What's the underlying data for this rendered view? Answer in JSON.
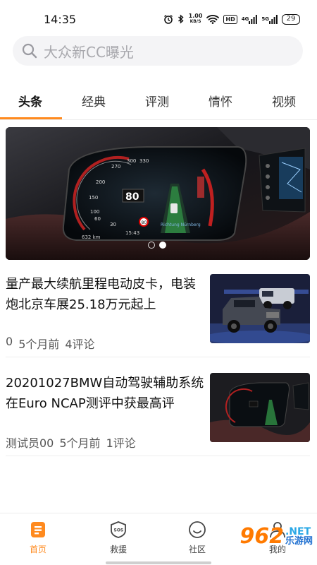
{
  "status_bar": {
    "time": "14:35",
    "speed_value": "1.00",
    "speed_unit": "KB/S",
    "hd_badge": "HD",
    "network_1": "4G",
    "network_2": "5G",
    "battery": "29",
    "icons": [
      "alarm-icon",
      "bluetooth-icon",
      "wifi-icon",
      "signal-icon"
    ]
  },
  "search": {
    "placeholder": "大众新CC曝光"
  },
  "tabs": [
    {
      "label": "头条",
      "active": true
    },
    {
      "label": "经典"
    },
    {
      "label": "评测"
    },
    {
      "label": "情怀"
    },
    {
      "label": "视频"
    }
  ],
  "banner": {
    "slides": 2,
    "active_slide": 2,
    "speed_readout": "80",
    "range_readout": "632",
    "clock_readout": "15:43",
    "nav_location": "Richtung Nürnberg",
    "gauge_ticks": [
      "300",
      "270",
      "330",
      "200",
      "150",
      "100",
      "60",
      "30"
    ]
  },
  "articles": [
    {
      "title": "量产最大续航里程电动皮卡，电装炮北京车展25.18万元起上",
      "author": "0",
      "time": "5个月前",
      "comments": "4评论",
      "thumb": "pickup-trucks-photo"
    },
    {
      "title": "20201027BMW自动驾驶辅助系统在Euro NCAP测评中获最高评",
      "author": "测试员00",
      "time": "5个月前",
      "comments": "1评论",
      "thumb": "dashboard-photo"
    }
  ],
  "bottom_nav": [
    {
      "label": "首页",
      "icon": "home-doc-icon",
      "active": true
    },
    {
      "label": "救援",
      "icon": "sos-icon"
    },
    {
      "label": "社区",
      "icon": "community-icon"
    },
    {
      "label": "我的",
      "icon": "profile-icon"
    }
  ],
  "watermark": {
    "main": "962",
    "net": ".NET",
    "cn": "乐游网"
  },
  "colors": {
    "accent": "#ff8a1e",
    "search_bg": "#f4f4f6",
    "text_primary": "#111111",
    "text_meta": "#555555"
  }
}
